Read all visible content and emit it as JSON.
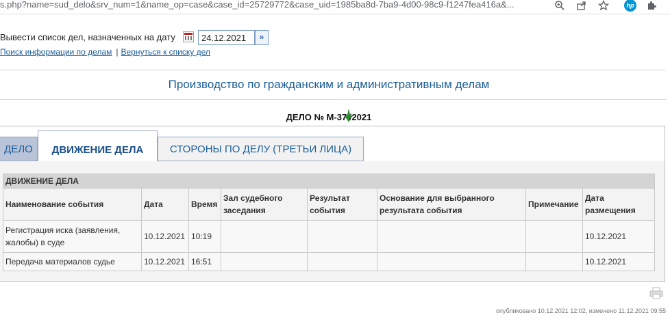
{
  "browser": {
    "url": "s.php?name=sud_delo&srv_num=1&name_op=case&case_id=25729772&case_uid=1985ba8d-7ba9-4d00-98c9-f1247fea416a&...",
    "icons": [
      "zoom-icon",
      "share-icon",
      "star-icon",
      "hp-icon",
      "extensions-icon"
    ],
    "hp_label": "hp"
  },
  "date_filter": {
    "label": "Вывести список дел, назначенных на дату",
    "value": "24.12.2021",
    "go_glyph": "»"
  },
  "links": {
    "search": "Поиск информации по делам",
    "separator": "|",
    "back": "Вернуться к списку дел"
  },
  "section_title": "Производство по гражданским и административным делам",
  "case_number": "ДЕЛО № М-37   /2021",
  "tabs": [
    {
      "label": "ДЕЛО"
    },
    {
      "label": "ДВИЖЕНИЕ ДЕЛА",
      "active": true
    },
    {
      "label": "СТОРОНЫ ПО ДЕЛУ (ТРЕТЬИ ЛИЦА)"
    }
  ],
  "events_table": {
    "caption": "ДВИЖЕНИЕ ДЕЛА",
    "headers": [
      "Наименование события",
      "Дата",
      "Время",
      "Зал судебного заседания",
      "Результат события",
      "Основание для выбранного результата события",
      "Примечание",
      "Дата размещения"
    ],
    "rows": [
      [
        "Регистрация иска (заявления, жалобы) в суде",
        "10.12.2021",
        "10:19",
        "",
        "",
        "",
        "",
        "10.12.2021"
      ],
      [
        "Передача материалов судье",
        "10.12.2021",
        "16:51",
        "",
        "",
        "",
        "",
        "10.12.2021"
      ]
    ]
  },
  "footer": "опубликовано 10.12.2021 12:02, изменено 11.12.2021 09:55",
  "colors": {
    "link": "#1a5d9a",
    "tab_inactive_bg": "#b9c4d8",
    "table_caption_bg": "#d4d4d4",
    "stamp": "#2a8a2a"
  }
}
